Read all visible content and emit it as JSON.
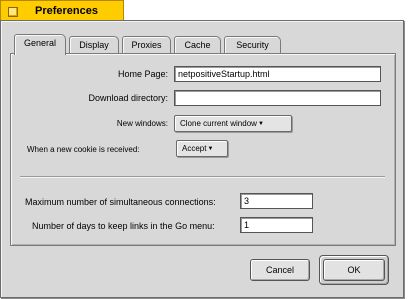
{
  "window": {
    "title": "Preferences"
  },
  "tabs": [
    {
      "label": "General",
      "active": true
    },
    {
      "label": "Display",
      "active": false
    },
    {
      "label": "Proxies",
      "active": false
    },
    {
      "label": "Cache",
      "active": false
    },
    {
      "label": "Security",
      "active": false
    }
  ],
  "general": {
    "home_page": {
      "label": "Home Page:",
      "value": "netpositiveStartup.html"
    },
    "download_directory": {
      "label": "Download directory:",
      "value": ""
    },
    "new_windows": {
      "label": "New windows:",
      "value": "Clone current window"
    },
    "new_cookie": {
      "label": "When a new cookie is received:",
      "value": "Accept"
    },
    "max_connections": {
      "label": "Maximum number of simultaneous connections:",
      "value": "3"
    },
    "keep_links_days": {
      "label": "Number of days to keep links in the Go menu:",
      "value": "1"
    }
  },
  "buttons": {
    "cancel": "Cancel",
    "ok": "OK"
  },
  "colors": {
    "title_tab": "#ffcc00",
    "window_bg": "#d8d8d8"
  },
  "icons": {
    "close_box": "close-box-icon",
    "popup_arrow": "popup-arrow-icon"
  }
}
